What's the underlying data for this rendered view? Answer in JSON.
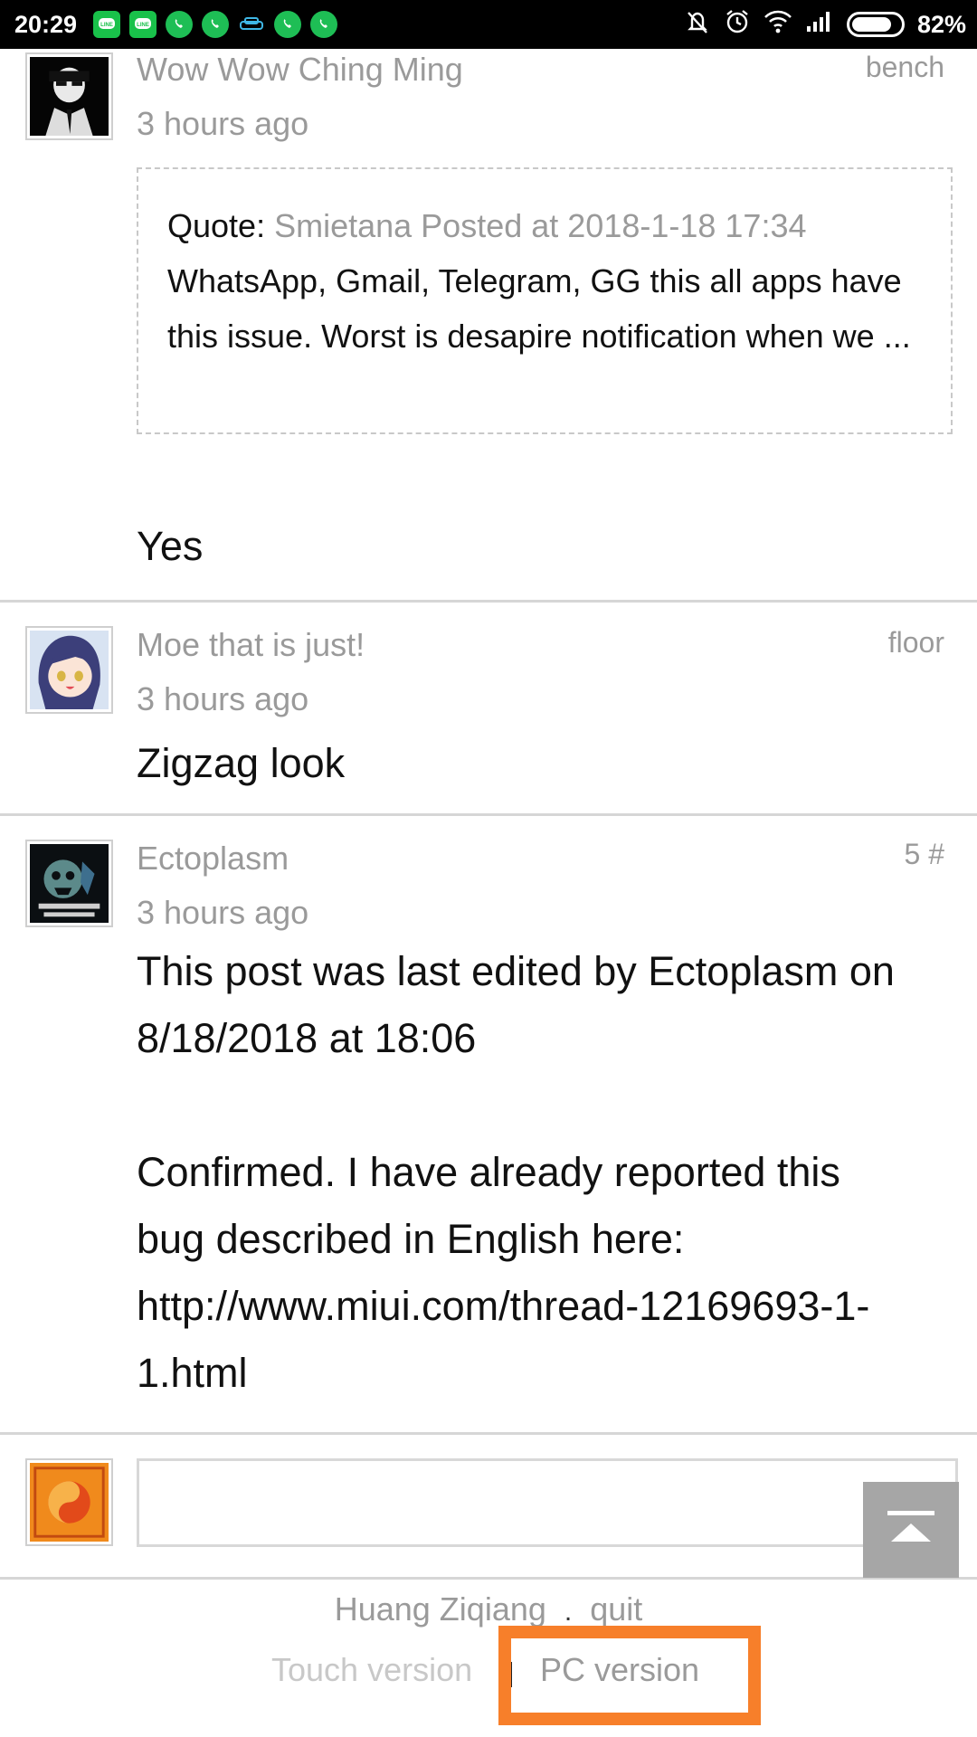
{
  "status_bar": {
    "time": "20:29",
    "battery": "82%",
    "notification_icons": [
      "line-icon",
      "line-icon",
      "whatsapp-icon",
      "whatsapp-icon",
      "car-icon",
      "whatsapp-icon",
      "whatsapp-icon"
    ],
    "status_icons": [
      "mute-icon",
      "alarm-icon",
      "wifi-icon",
      "signal-icon",
      "battery-icon"
    ],
    "battery_level": 0.82
  },
  "posts": [
    {
      "author": "Wow Wow Ching Ming",
      "time": "3 hours ago",
      "floor": "bench",
      "quote": {
        "label": "Quote: ",
        "source": "Smietana Posted at 2018-1-18 17:34",
        "text": "WhatsApp, Gmail, Telegram, GG this all apps have this issue. Worst is desapire notification when we ..."
      },
      "body": "Yes"
    },
    {
      "author": "Moe that is just!",
      "time": "3 hours ago",
      "floor": "floor",
      "body": "Zigzag look"
    },
    {
      "author": "Ectoplasm",
      "time": "3 hours ago",
      "floor": "5 #",
      "body_lines": [
        "This post was last edited by Ectoplasm on",
        "8/18/2018 at 18:06",
        "",
        "Confirmed. I have already reported this",
        "bug described in English here:",
        "http://www.miui.com/thread-12169693-1-",
        "1.html"
      ]
    }
  ],
  "reply": {
    "placeholder": ""
  },
  "footer": {
    "username": "Huang Ziqiang",
    "separator": ".",
    "quit": "quit",
    "touch_version": "Touch version",
    "pc_version": "PC version"
  },
  "colors": {
    "highlight": "#f77f2a",
    "meta_text": "#9a9a9a",
    "divider": "#d6d6d6"
  }
}
